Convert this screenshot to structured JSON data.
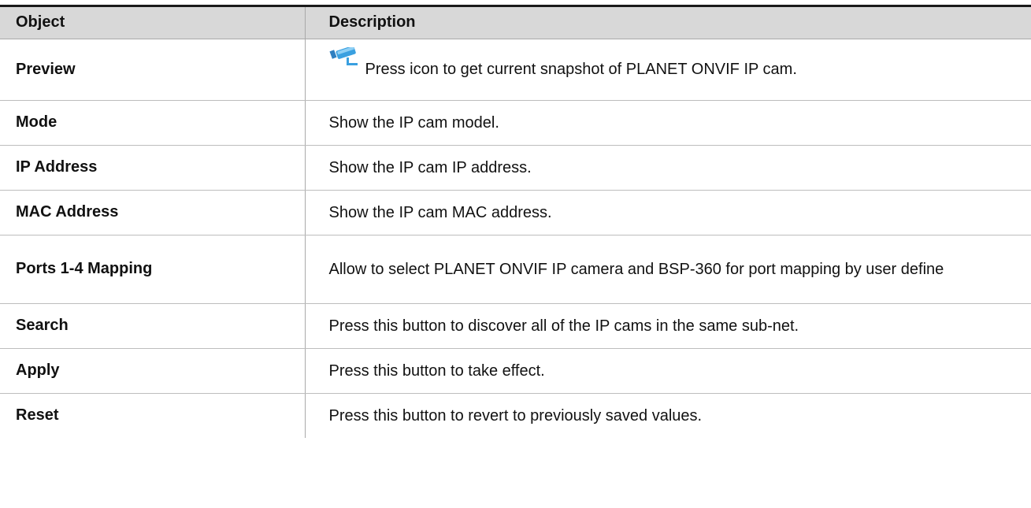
{
  "table": {
    "headers": {
      "object": "Object",
      "description": "Description"
    },
    "rows": [
      {
        "name": "Preview",
        "description": "Press icon to get current snapshot of PLANET ONVIF IP cam.",
        "icon": "camera-icon"
      },
      {
        "name": "Mode",
        "description": "Show the IP cam model."
      },
      {
        "name": "IP Address",
        "description": "Show the IP cam IP address."
      },
      {
        "name": "MAC Address",
        "description": "Show the IP cam MAC address."
      },
      {
        "name": "Ports 1-4 Mapping",
        "description": "Allow to select PLANET ONVIF IP camera and BSP-360 for port mapping by user define"
      },
      {
        "name": "Search",
        "description": "Press this button to discover all of the IP cams in the same sub-net."
      },
      {
        "name": "Apply",
        "description": "Press this button to take effect."
      },
      {
        "name": "Reset",
        "description": "Press this button to revert to previously saved values."
      }
    ]
  },
  "colors": {
    "header_bg": "#d8d8d8",
    "rule": "#1a1a1a",
    "camera_icon": "#3aa0e0"
  }
}
